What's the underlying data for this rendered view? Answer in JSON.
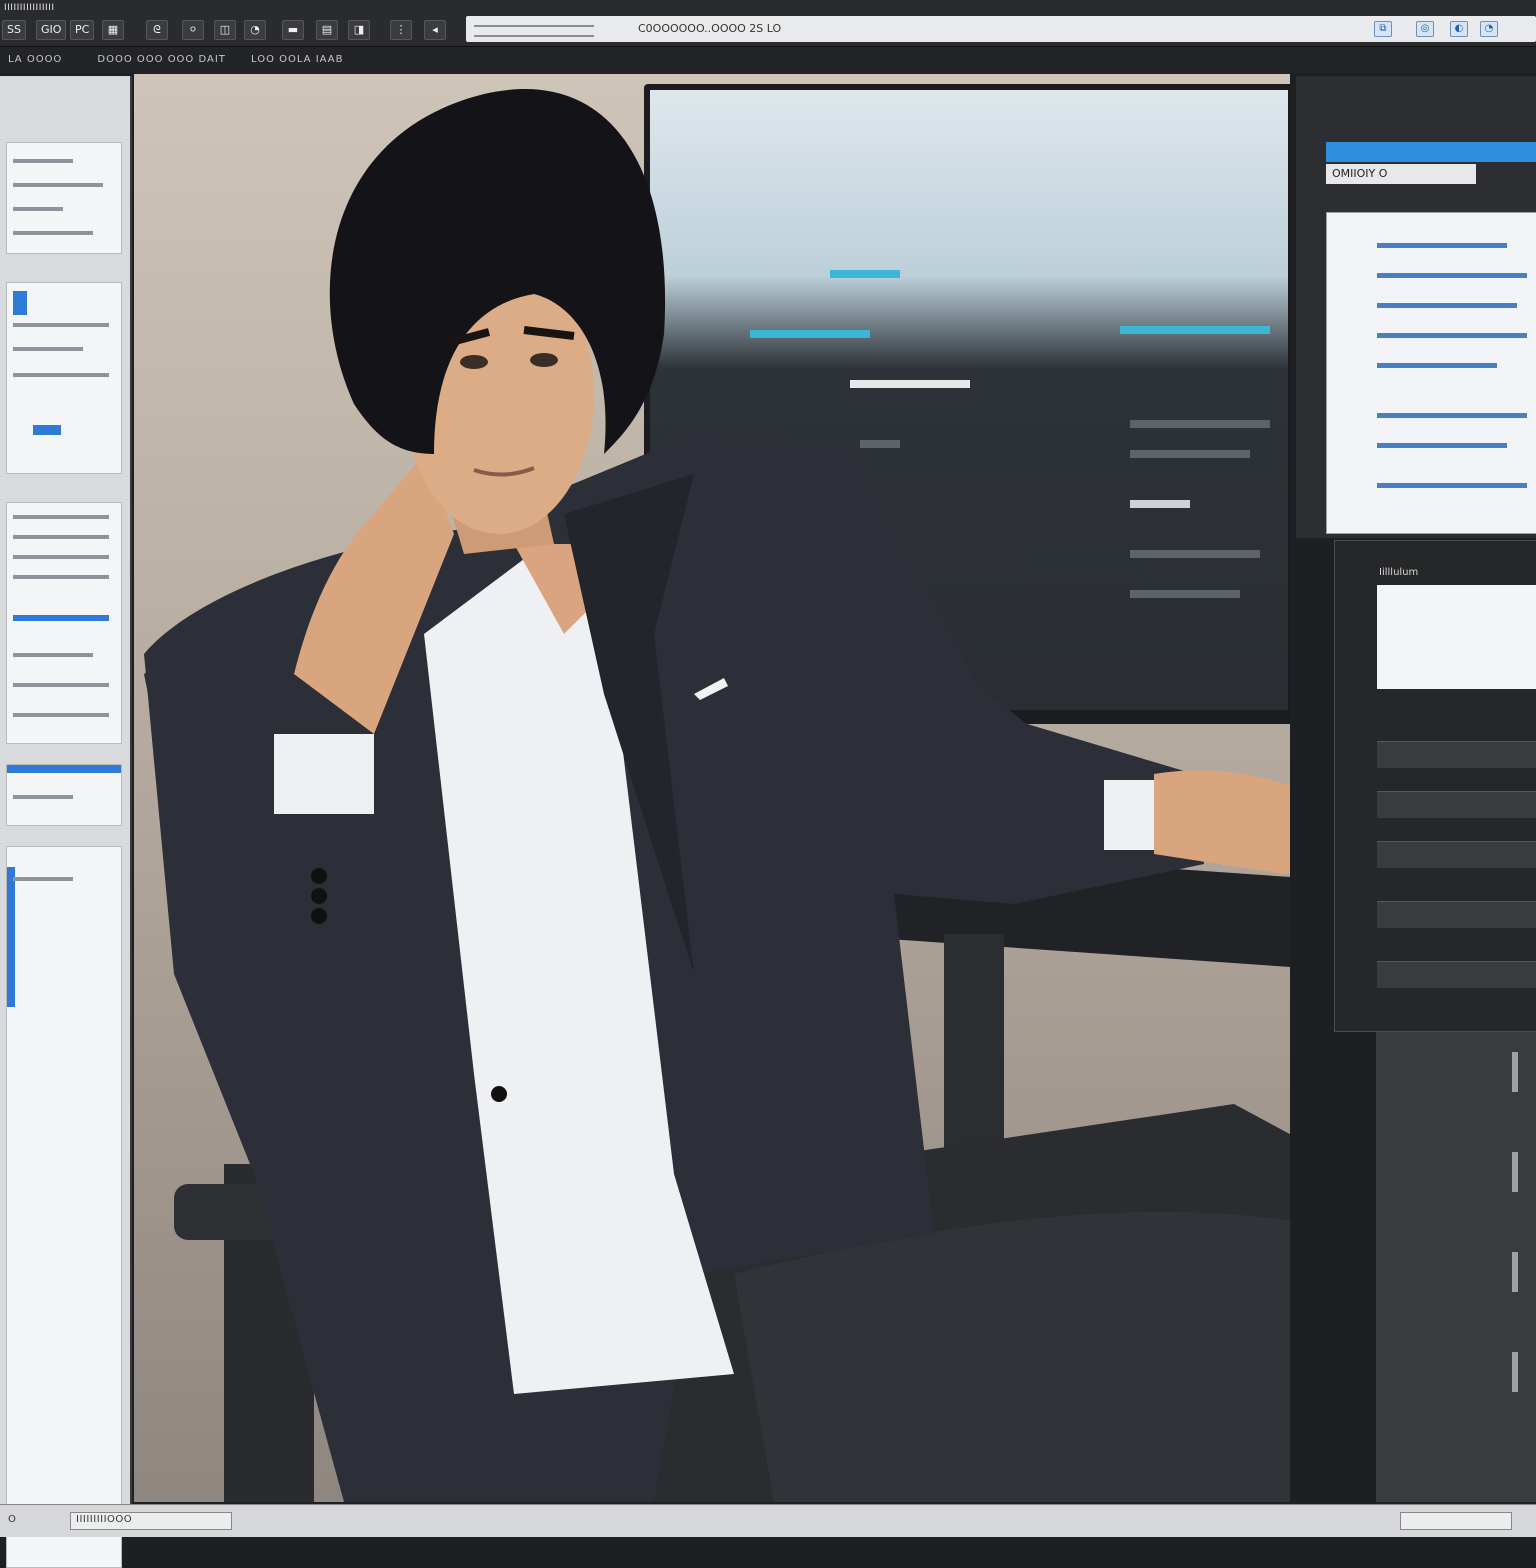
{
  "app": {
    "title": "IIIIIIIIIIIIIIII"
  },
  "toolbar": {
    "buttons": [
      "SS",
      "GIO",
      "PC",
      "▦",
      "ᘓ",
      "⚪",
      "◫",
      "◔",
      "▬",
      "▤",
      "◨",
      "⋮",
      "◂"
    ]
  },
  "addressbar": {
    "text": "C0OOOOOO..OOOO   2S LO",
    "icons": [
      "⧉",
      "◎",
      "◐",
      "◔"
    ]
  },
  "menubar": {
    "items": [
      "LA OOOO",
      "DOOO OOO OOO DAIT",
      "LOO OOLA IAAB"
    ]
  },
  "right_panel": {
    "header_text": "OMIIOIY   O",
    "mid_title": "Iilllulum"
  },
  "statusbar": {
    "left": "O",
    "text": "IIIIIIIIIOOO"
  },
  "colors": {
    "accent_blue": "#2f8ee0",
    "chrome_dark": "#2a2b2e",
    "panel_light": "#f4f5f7"
  }
}
